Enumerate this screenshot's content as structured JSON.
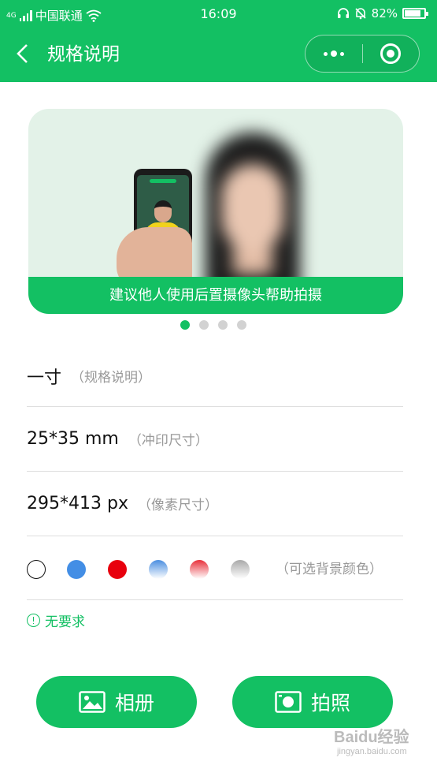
{
  "status_bar": {
    "network_type": "4G",
    "carrier": "中国联通",
    "time": "16:09",
    "battery_percent": "82%",
    "battery_level": 0.82
  },
  "header": {
    "title": "规格说明",
    "back_icon": "chevron-left-icon",
    "more_icon": "more-dots-icon",
    "close_icon": "record-circle-icon"
  },
  "banner": {
    "caption": "建议他人使用后置摄像头帮助拍摄",
    "active_slide": 1,
    "slide_count": 4
  },
  "specs": [
    {
      "value": "一寸",
      "note": "（规格说明）"
    },
    {
      "value": "25*35 mm",
      "note": "（冲印尺寸）"
    },
    {
      "value": "295*413 px",
      "note": "（像素尺寸）"
    }
  ],
  "background_colors": {
    "note": "（可选背景颜色）",
    "options": [
      "white",
      "blue",
      "red",
      "blue-gradient",
      "red-gradient",
      "gray-gradient"
    ],
    "colors": [
      "#ffffff",
      "#438ee5",
      "#e8000d",
      "#4a8ee0",
      "#e8313b",
      "#a9a9a9"
    ]
  },
  "requirement": {
    "icon": "info-circle-icon",
    "text": "无要求"
  },
  "buttons": {
    "album_label": "相册",
    "album_icon": "image-icon",
    "camera_label": "拍照",
    "camera_icon": "camera-icon"
  },
  "watermark": {
    "brand": "Baidu经验",
    "url": "jingyan.baidu.com"
  },
  "theme": {
    "accent": "#13c063"
  }
}
